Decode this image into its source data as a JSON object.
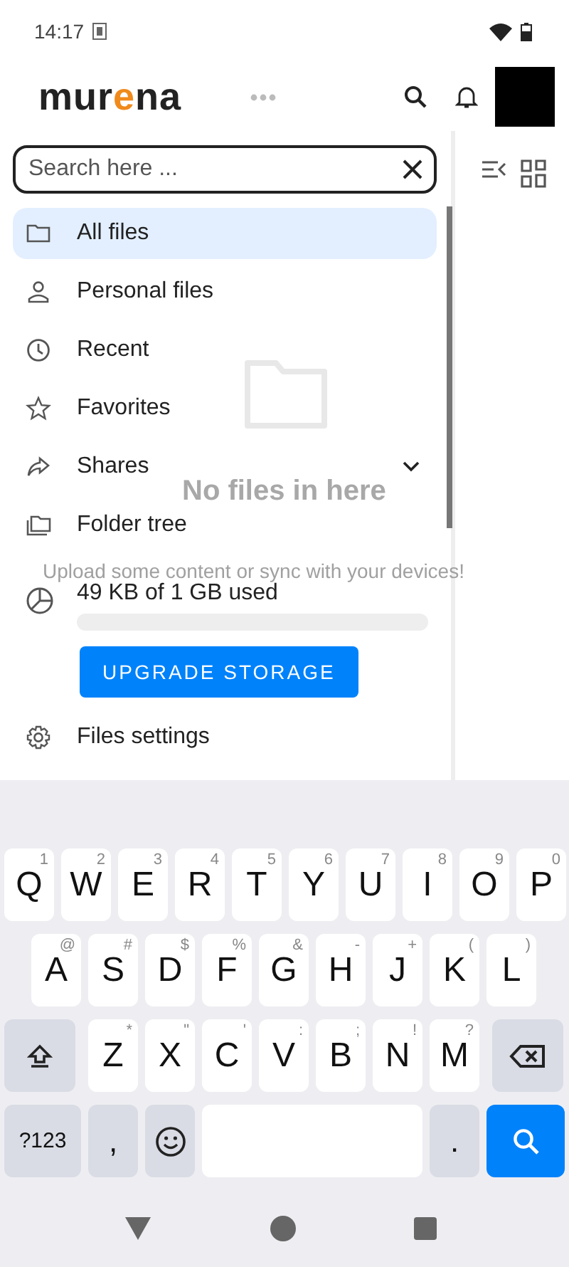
{
  "status_bar": {
    "time": "14:17"
  },
  "header": {
    "logo": [
      {
        "text": "mur",
        "accent": false
      },
      {
        "text": "e",
        "accent": true
      },
      {
        "text": "na",
        "accent": false
      }
    ]
  },
  "search": {
    "placeholder": "Search here ..."
  },
  "sidebar": {
    "items": [
      {
        "kind": "link",
        "label": "All files",
        "selected": true
      },
      {
        "kind": "link",
        "label": "Personal files",
        "selected": false
      },
      {
        "kind": "link",
        "label": "Recent",
        "selected": false
      },
      {
        "kind": "link",
        "label": "Favorites",
        "selected": false
      },
      {
        "kind": "group",
        "label": "Shares",
        "selected": false
      },
      {
        "kind": "link",
        "label": "Folder tree",
        "selected": false
      }
    ],
    "storage": {
      "text": "49 KB of 1 GB used",
      "level": 0
    },
    "upgrade_button": "UPGRADE STORAGE",
    "settings": "Files settings"
  },
  "empty_state": {
    "title": "No files in here",
    "subtitle": "Upload some content or sync with your devices!"
  },
  "keyboard": {
    "rows": [
      {
        "keys": [
          {
            "kind": "key",
            "label": "Q",
            "hint": "1"
          },
          {
            "kind": "key",
            "label": "W",
            "hint": "2"
          },
          {
            "kind": "key",
            "label": "E",
            "hint": "3"
          },
          {
            "kind": "key",
            "label": "R",
            "hint": "4"
          },
          {
            "kind": "key",
            "label": "T",
            "hint": "5"
          },
          {
            "kind": "key",
            "label": "Y",
            "hint": "6"
          },
          {
            "kind": "key",
            "label": "U",
            "hint": "7"
          },
          {
            "kind": "key",
            "label": "I",
            "hint": "8"
          },
          {
            "kind": "key",
            "label": "O",
            "hint": "9"
          },
          {
            "kind": "key",
            "label": "P",
            "hint": "0"
          }
        ]
      },
      {
        "keys": [
          {
            "kind": "key",
            "label": "A",
            "hint": "@"
          },
          {
            "kind": "key",
            "label": "S",
            "hint": "#"
          },
          {
            "kind": "key",
            "label": "D",
            "hint": "$"
          },
          {
            "kind": "key",
            "label": "F",
            "hint": "%"
          },
          {
            "kind": "key",
            "label": "G",
            "hint": "&"
          },
          {
            "kind": "key",
            "label": "H",
            "hint": "-"
          },
          {
            "kind": "key",
            "label": "J",
            "hint": "+"
          },
          {
            "kind": "key",
            "label": "K",
            "hint": "("
          },
          {
            "kind": "key",
            "label": "L",
            "hint": ")"
          }
        ]
      },
      {
        "keys": [
          {
            "kind": "shift"
          },
          {
            "kind": "key",
            "label": "Z",
            "hint": "*"
          },
          {
            "kind": "key",
            "label": "X",
            "hint": "\""
          },
          {
            "kind": "key",
            "label": "C",
            "hint": "'"
          },
          {
            "kind": "key",
            "label": "V",
            "hint": ":"
          },
          {
            "kind": "key",
            "label": "B",
            "hint": ";"
          },
          {
            "kind": "key",
            "label": "N",
            "hint": "!"
          },
          {
            "kind": "key",
            "label": "M",
            "hint": "?"
          },
          {
            "kind": "delete"
          }
        ]
      },
      {
        "keys": [
          {
            "kind": "mode",
            "label": "?123"
          },
          {
            "kind": "punct",
            "label": ","
          },
          {
            "kind": "emoji"
          },
          {
            "kind": "space"
          },
          {
            "kind": "punct",
            "label": "."
          },
          {
            "kind": "search"
          }
        ]
      }
    ]
  }
}
